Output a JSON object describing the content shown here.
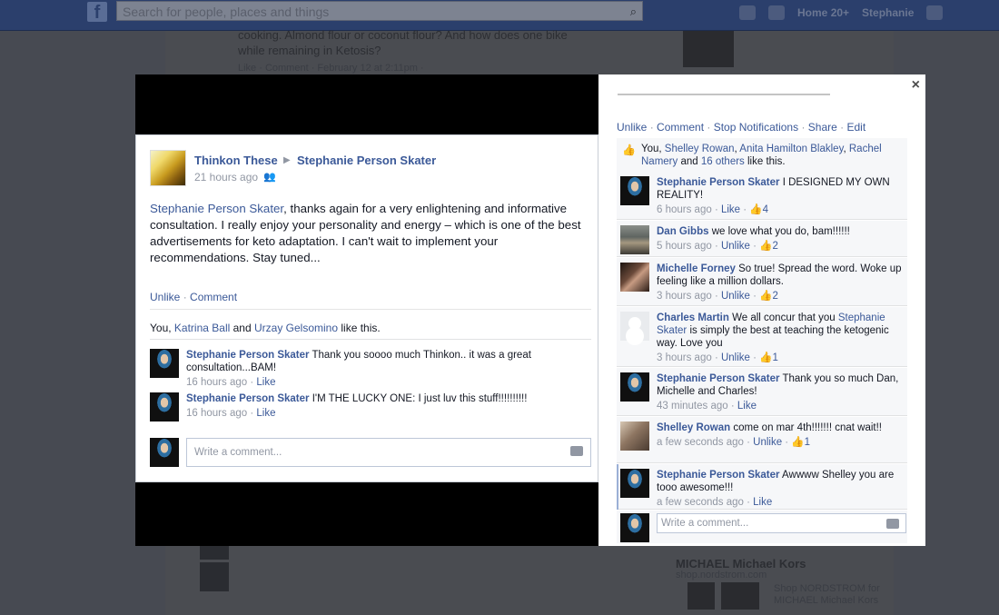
{
  "background": {
    "search_placeholder": "Search for people, places and things",
    "nav_home": "Home",
    "nav_home_count": "20+",
    "nav_user": "Stephanie",
    "post_text_line1": "cooking.  Almond flour or coconut flour?  And how does one bike",
    "post_text_line2": "while remaining in Ketosis?",
    "post_meta": "Like · Comment · February 12 at 2:11pm · ",
    "ad_title": "MICHAEL Michael Kors",
    "ad_url": "shop.nordstrom.com",
    "ad_text1": "Shop NORDSTROM for",
    "ad_text2": "MICHAEL Michael Kors"
  },
  "post": {
    "author": "Thinkon These",
    "arrow": "▶",
    "target": "Stephanie Person Skater",
    "time": "21 hours ago",
    "body_link": "Stephanie Person Skater",
    "body_text": ", thanks again for a very enlightening and informative consultation. I really enjoy your personality and energy – which is one of the best advertisements for keto adaptation. I can't wait to implement your recommendations. Stay tuned...",
    "action_unlike": "Unlike",
    "action_comment": "Comment",
    "likes_prefix": "You, ",
    "likes_name1": "Katrina Ball",
    "likes_and": " and ",
    "likes_name2": "Urzay Gelsomino",
    "likes_suffix": " like this.",
    "comments": [
      {
        "name": "Stephanie Person Skater",
        "text": " Thank you soooo much Thinkon.. it was a great consultation...BAM!",
        "time": "16 hours ago",
        "like": "Like"
      },
      {
        "name": "Stephanie Person Skater",
        "text": " I'M THE LUCKY ONE: I just luv this stuff!!!!!!!!!!",
        "time": "16 hours ago",
        "like": "Like"
      }
    ],
    "write_placeholder": "Write a comment..."
  },
  "pane": {
    "close": "×",
    "action_unlike": "Unlike",
    "action_comment": "Comment",
    "action_stop": "Stop Notifications",
    "action_share": "Share",
    "action_edit": "Edit",
    "likes_prefix": "You, ",
    "likes_n1": "Shelley Rowan",
    "likes_n2": "Anita Hamilton Blakley",
    "likes_n3": "Rachel Namery",
    "likes_and": " and ",
    "likes_others": "16 others",
    "likes_suffix": " like this.",
    "comments": [
      {
        "name": "Stephanie Person Skater",
        "pre": " I DESIGNED MY OWN REALITY!",
        "mention": "",
        "post": "",
        "time": "6 hours ago",
        "like": "Like",
        "count": "4"
      },
      {
        "name": "Dan Gibbs",
        "pre": " we love what you do, bam!!!!!!",
        "mention": "",
        "post": "",
        "time": "5 hours ago",
        "like": "Unlike",
        "count": "2"
      },
      {
        "name": "Michelle Forney",
        "pre": " So true! Spread the word. Woke up feeling like a million dollars.",
        "mention": "",
        "post": "",
        "time": "3 hours ago",
        "like": "Unlike",
        "count": "2"
      },
      {
        "name": "Charles Martin",
        "pre": " We all concur that you ",
        "mention": "Stephanie Skater",
        "post": " is simply the best at teaching the ketogenic way. Love you",
        "time": "3 hours ago",
        "like": "Unlike",
        "count": "1"
      },
      {
        "name": "Stephanie Person Skater",
        "pre": " Thank you so much Dan, Michelle and Charles!",
        "mention": "",
        "post": "",
        "time": "43 minutes ago",
        "like": "Like",
        "count": ""
      },
      {
        "name": "Shelley Rowan",
        "pre": " come on mar 4th!!!!!!! cnat wait!!",
        "mention": "",
        "post": "",
        "time": "a few seconds ago",
        "like": "Unlike",
        "count": "1"
      },
      {
        "name": "Stephanie Person Skater",
        "pre": " Awwww Shelley you are tooo awesome!!!",
        "mention": "",
        "post": "",
        "time": "a few seconds ago",
        "like": "Like",
        "count": ""
      }
    ],
    "write_placeholder": "Write a comment..."
  },
  "colors": {
    "link": "#3b5998",
    "meta": "#9197a3",
    "topbar": "#2b3f6c"
  }
}
